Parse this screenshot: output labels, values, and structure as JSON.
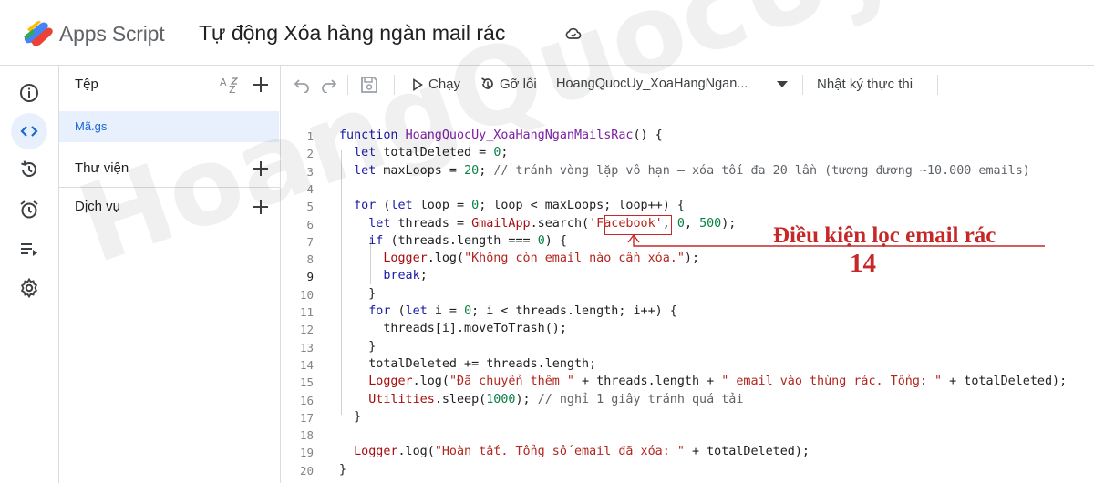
{
  "header": {
    "app_name": "Apps Script",
    "project_title": "Tự động Xóa hàng ngàn mail rác"
  },
  "files_panel": {
    "files_label": "Tệp",
    "file_name": "Mã.gs",
    "libraries_label": "Thư viện",
    "services_label": "Dịch vụ"
  },
  "toolbar": {
    "run_label": "Chạy",
    "debug_label": "Gỡ lỗi",
    "function_select": "HoangQuocUy_XoaHangNgan...",
    "log_label": "Nhật ký thực thi"
  },
  "code_lines": [
    {
      "n": "1",
      "tokens": [
        [
          "kw",
          "function "
        ],
        [
          "fn",
          "HoangQuocUy_XoaHangNganMailsRac"
        ],
        [
          "",
          "() {"
        ]
      ]
    },
    {
      "n": "2",
      "tokens": [
        [
          "",
          "  "
        ],
        [
          "kw",
          "let "
        ],
        [
          "",
          "totalDeleted = "
        ],
        [
          "num",
          "0"
        ],
        [
          "",
          ";"
        ]
      ]
    },
    {
      "n": "3",
      "tokens": [
        [
          "",
          "  "
        ],
        [
          "kw",
          "let "
        ],
        [
          "",
          "maxLoops = "
        ],
        [
          "num",
          "20"
        ],
        [
          "",
          "; "
        ],
        [
          "cmt",
          "// tránh vòng lặp vô hạn – xóa tối đa 20 lần (tương đương ~10.000 emails)"
        ]
      ]
    },
    {
      "n": "4",
      "tokens": []
    },
    {
      "n": "5",
      "tokens": [
        [
          "",
          "  "
        ],
        [
          "kw",
          "for "
        ],
        [
          "",
          "("
        ],
        [
          "kw",
          "let "
        ],
        [
          "",
          "loop = "
        ],
        [
          "num",
          "0"
        ],
        [
          "",
          "; loop < maxLoops; loop++) {"
        ]
      ]
    },
    {
      "n": "6",
      "tokens": [
        [
          "",
          "    "
        ],
        [
          "kw",
          "let "
        ],
        [
          "",
          "threads = "
        ],
        [
          "obj",
          "GmailApp"
        ],
        [
          "",
          ".search("
        ],
        [
          "str",
          "'Facebook'"
        ],
        [
          "",
          ", "
        ],
        [
          "num",
          "0"
        ],
        [
          "",
          ", "
        ],
        [
          "num",
          "500"
        ],
        [
          "",
          ");"
        ]
      ]
    },
    {
      "n": "7",
      "tokens": [
        [
          "",
          "    "
        ],
        [
          "kw",
          "if "
        ],
        [
          "",
          "(threads.length === "
        ],
        [
          "num",
          "0"
        ],
        [
          "",
          ") {"
        ]
      ]
    },
    {
      "n": "8",
      "tokens": [
        [
          "",
          "      "
        ],
        [
          "obj",
          "Logger"
        ],
        [
          "",
          ".log("
        ],
        [
          "str",
          "\"Không còn email nào cần xóa.\""
        ],
        [
          "",
          ");"
        ]
      ]
    },
    {
      "n": "9",
      "tokens": [
        [
          "",
          "      "
        ],
        [
          "kw",
          "break"
        ],
        [
          "",
          ";"
        ]
      ]
    },
    {
      "n": "10",
      "tokens": [
        [
          "",
          "    }"
        ]
      ]
    },
    {
      "n": "11",
      "tokens": [
        [
          "",
          "    "
        ],
        [
          "kw",
          "for "
        ],
        [
          "",
          "("
        ],
        [
          "kw",
          "let "
        ],
        [
          "",
          "i = "
        ],
        [
          "num",
          "0"
        ],
        [
          "",
          "; i < threads.length; i++) {"
        ]
      ]
    },
    {
      "n": "12",
      "tokens": [
        [
          "",
          "      threads[i].moveToTrash();"
        ]
      ]
    },
    {
      "n": "13",
      "tokens": [
        [
          "",
          "    }"
        ]
      ]
    },
    {
      "n": "14",
      "tokens": [
        [
          "",
          "    totalDeleted += threads.length;"
        ]
      ]
    },
    {
      "n": "15",
      "tokens": [
        [
          "",
          "    "
        ],
        [
          "obj",
          "Logger"
        ],
        [
          "",
          ".log("
        ],
        [
          "str",
          "\"Đã chuyển thêm \""
        ],
        [
          "",
          " + threads.length + "
        ],
        [
          "str",
          "\" email vào thùng rác. Tổng: \""
        ],
        [
          "",
          " + totalDeleted);"
        ]
      ]
    },
    {
      "n": "16",
      "tokens": [
        [
          "",
          "    "
        ],
        [
          "obj",
          "Utilities"
        ],
        [
          "",
          ".sleep("
        ],
        [
          "num",
          "1000"
        ],
        [
          "",
          "); "
        ],
        [
          "cmt",
          "// nghỉ 1 giây tránh quá tải"
        ]
      ]
    },
    {
      "n": "17",
      "tokens": [
        [
          "",
          "  }"
        ]
      ]
    },
    {
      "n": "18",
      "tokens": []
    },
    {
      "n": "19",
      "tokens": [
        [
          "",
          "  "
        ],
        [
          "obj",
          "Logger"
        ],
        [
          "",
          ".log("
        ],
        [
          "str",
          "\"Hoàn tất. Tổng số email đã xóa: \""
        ],
        [
          "",
          " + totalDeleted);"
        ]
      ]
    },
    {
      "n": "20",
      "tokens": [
        [
          "",
          "}"
        ]
      ]
    }
  ],
  "annotation": {
    "text": "Điều kiện lọc email rác",
    "number": "14"
  },
  "watermark": "HoangQuocUy.com",
  "colors": {
    "accent": "#1967d2",
    "annotation": "#c62828",
    "selected_bg": "#e8f0fe"
  }
}
